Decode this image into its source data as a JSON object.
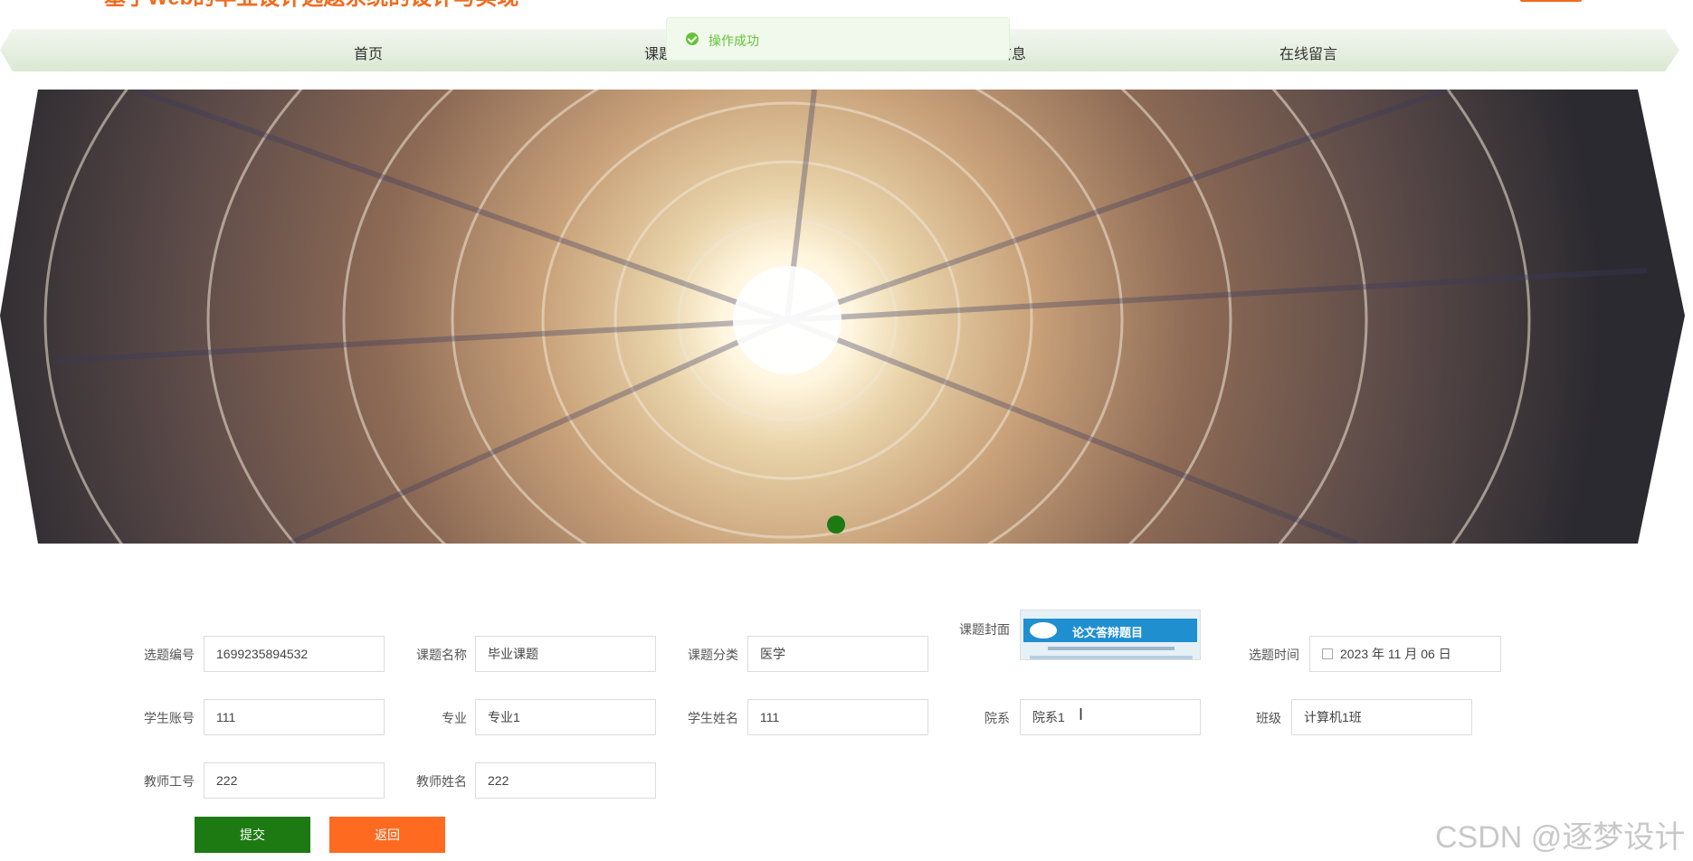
{
  "header": {
    "site_title": "基于Web的毕业设计选题系统的设计与实现"
  },
  "nav": {
    "items": [
      "首页",
      "课题信息",
      "",
      "公告信息",
      "在线留言"
    ]
  },
  "toast": {
    "message": "操作成功"
  },
  "form": {
    "fields": [
      {
        "label": "选题编号",
        "value": "1699235894532"
      },
      {
        "label": "课题名称",
        "value": "毕业课题"
      },
      {
        "label": "课题分类",
        "value": "医学"
      },
      {
        "label": "课题封面",
        "value": ""
      },
      {
        "label": "选题时间",
        "value": "2023 年 11 月 06 日"
      },
      {
        "label": "学生账号",
        "value": "111"
      },
      {
        "label": "专业",
        "value": "专业1"
      },
      {
        "label": "学生姓名",
        "value": "111"
      },
      {
        "label": "院系",
        "value": "院系1"
      },
      {
        "label": "班级",
        "value": "计算机1班"
      },
      {
        "label": "教师工号",
        "value": "222"
      },
      {
        "label": "教师姓名",
        "value": "222"
      }
    ],
    "cover_text": "论文答辩题目",
    "submit_label": "提交",
    "back_label": "返回"
  },
  "watermark": "CSDN @逐梦设计",
  "colors": {
    "accent_green": "#1d7a13",
    "accent_orange": "#ff6a21",
    "title_orange": "#f26b1d",
    "toast_green": "#67c23a"
  }
}
